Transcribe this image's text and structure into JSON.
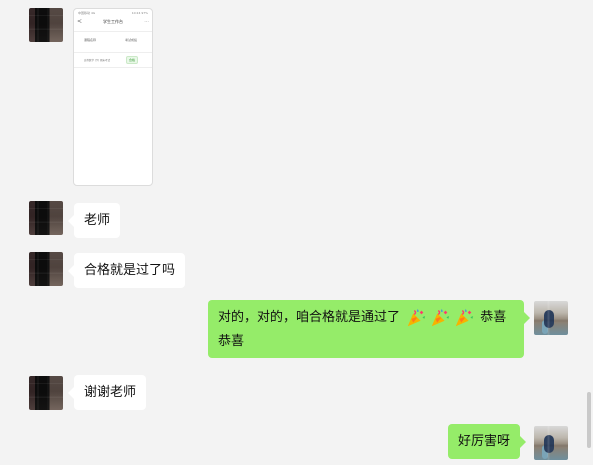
{
  "messages": [
    {
      "side": "left",
      "type": "image"
    },
    {
      "side": "left",
      "text": "老师"
    },
    {
      "side": "left",
      "text": "合格就是过了吗"
    },
    {
      "side": "right",
      "line1": "对的，对的，咱合格就是通过了",
      "line1_end": "恭喜",
      "line2": "恭喜"
    },
    {
      "side": "left",
      "text": "谢谢老师"
    },
    {
      "side": "right",
      "text": "好厉害呀"
    }
  ],
  "shot": {
    "status_left": "中国移动 4G",
    "status_right": "10:24 97%",
    "title": "学生工作台",
    "back": "<",
    "more": "...",
    "col1": "课程名称",
    "col2": "考试成绩",
    "row": "高等数学 (下) 期末考试",
    "badge": "合格"
  },
  "colors": {
    "chat_bg": "#f3f3f3",
    "bubble_left": "#ffffff",
    "bubble_right": "#95ec69"
  },
  "icons": [
    "party-popper-icon"
  ]
}
